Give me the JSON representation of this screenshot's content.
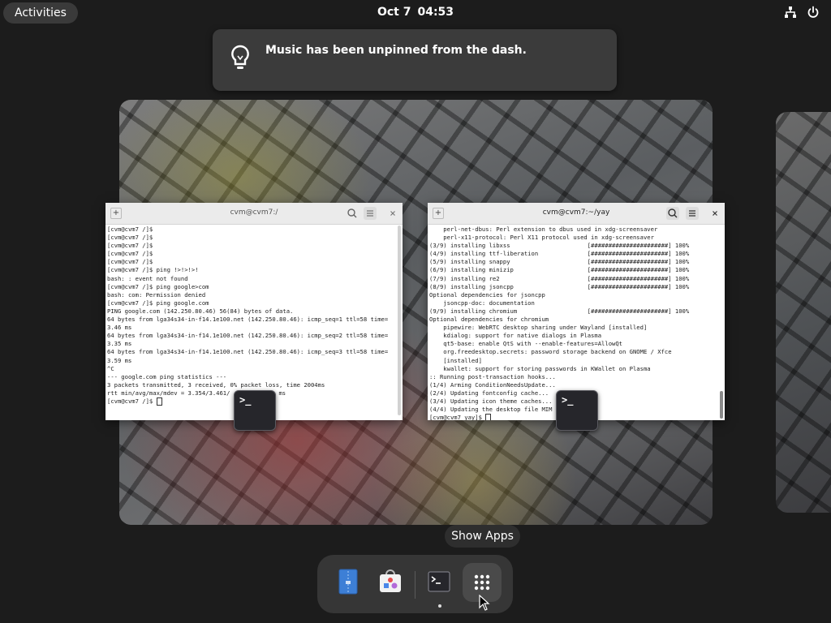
{
  "topbar": {
    "activities_label": "Activities",
    "date": "Oct 7",
    "time": "04:53",
    "icons": [
      "network-icon",
      "power-icon"
    ]
  },
  "notification": {
    "icon": "lightbulb-icon",
    "message": "Music has been unpinned from the dash."
  },
  "windows": [
    {
      "title": "cvm@cvm7:/",
      "lines": [
        "[cvm@cvm7 /]$",
        "[cvm@cvm7 /]$",
        "[cvm@cvm7 /]$",
        "[cvm@cvm7 /]$",
        "[cvm@cvm7 /]$",
        "[cvm@cvm7 /]$ ping !>!>!>!",
        "bash: : event not found",
        "[cvm@cvm7 /]$ ping google>com",
        "bash: com: Permission denied",
        "[cvm@cvm7 /]$ ping google.com",
        "PING google.com (142.250.80.46) 56(84) bytes of data.",
        "64 bytes from lga34s34-in-f14.1e100.net (142.250.80.46): icmp_seq=1 ttl=58 time=",
        "3.46 ms",
        "64 bytes from lga34s34-in-f14.1e100.net (142.250.80.46): icmp_seq=2 ttl=58 time=",
        "3.35 ms",
        "64 bytes from lga34s34-in-f14.1e100.net (142.250.80.46): icmp_seq=3 ttl=58 time=",
        "3.59 ms",
        "^C",
        "--- google.com ping statistics ---",
        "3 packets transmitted, 3 received, 0% packet loss, time 2004ms",
        "rtt min/avg/max/mdev = 3.354/3.461/",
        "[cvm@cvm7 /]$ "
      ],
      "line_suffix": "ms"
    },
    {
      "title": "cvm@cvm7:~/yay",
      "lines": [
        "    perl-net-dbus: Perl extension to dbus used in xdg-screensaver",
        "    perl-x11-protocol: Perl X11 protocol used in xdg-screensaver",
        "(3/9) installing libxss                      [######################] 100%",
        "(4/9) installing ttf-liberation              [######################] 100%",
        "(5/9) installing snappy                      [######################] 100%",
        "(6/9) installing minizip                     [######################] 100%",
        "(7/9) installing re2                         [######################] 100%",
        "(8/9) installing jsoncpp                     [######################] 100%",
        "Optional dependencies for jsoncpp",
        "    jsoncpp-doc: documentation",
        "(9/9) installing chromium                    [######################] 100%",
        "Optional dependencies for chromium",
        "    pipewire: WebRTC desktop sharing under Wayland [installed]",
        "    kdialog: support for native dialogs in Plasma",
        "    qt5-base: enable QtS with --enable-features=AllowQt",
        "    org.freedesktop.secrets: password storage backend on GNOME / Xfce",
        "    [installed]",
        "    kwallet: support for storing passwords in KWallet on Plasma",
        ":: Running post-transaction hooks...",
        "(1/4) Arming ConditionNeedsUpdate...",
        "(2/4) Updating fontconfig cache...",
        "(3/4) Updating icon theme caches...",
        "(4/4) Updating the desktop file MIM",
        "[cvm@cvm7 yay]$ "
      ]
    }
  ],
  "tooltip": "Show Apps",
  "dash": {
    "items": [
      "files-icon",
      "software-icon",
      "terminal-icon",
      "show-apps-icon"
    ],
    "colors": {
      "files": "#3d7fd6",
      "terminal_bg": "#26262b"
    }
  }
}
